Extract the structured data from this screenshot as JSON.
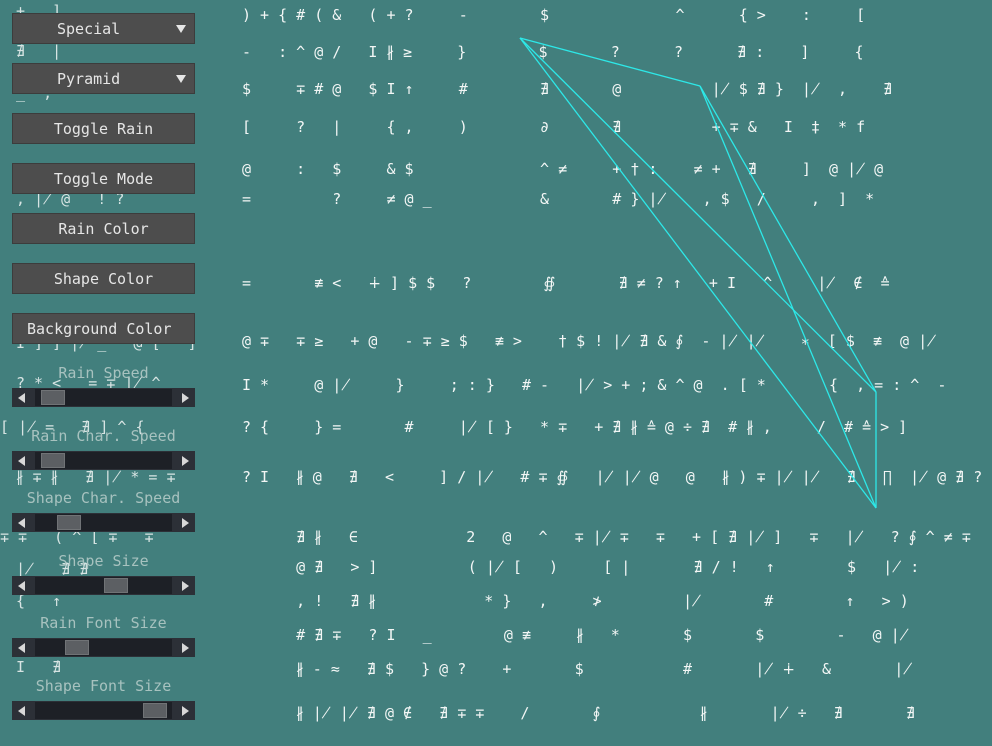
{
  "colors": {
    "background": "#427f7d",
    "rain": "#f2f6f5",
    "shape": "#2de8e8"
  },
  "controls": {
    "effect_dropdown": "Special",
    "shape_dropdown": "Pyramid",
    "toggle_rain": "Toggle Rain",
    "toggle_mode": "Toggle Mode",
    "rain_color": "Rain Color",
    "shape_color": "Shape Color",
    "background_color": "Background Color"
  },
  "sliders": [
    {
      "label": "Rain Speed",
      "value": 0.05
    },
    {
      "label": "Rain Char. Speed",
      "value": 0.05
    },
    {
      "label": "Shape Char. Speed",
      "value": 0.2
    },
    {
      "label": "Shape Size",
      "value": 0.62
    },
    {
      "label": "Rain Font Size",
      "value": 0.27
    },
    {
      "label": "Shape Font Size",
      "value": 0.97
    }
  ],
  "rain_rows": [
    ") + { # ( &   ( + ?     -        $              ^      { >    :     [",
    "-   : ^ @ /   I ∦ ≥     }        $       ?      ?      ∄ :    ]     {",
    "$     ∓ # @   $ I ↑     #        ∄       @          ∤ $ ∄ }  ∤  ,    ∄",
    "[     ?   |     { ,     )        ∂       ∄          + ∓ &   I  ‡  * f",
    "@     :   $     & $              ^ ≠     + † :    ≠ +   ∄     ]  @ ∤ @",
    "=         ?     ≠ @ _            &       # } ∤    , $   /     ,  ]  *",
    "=       ≢ <   ∔ ] $ $   ?        ∯       ∄ ≠ ? ↑   + I   ^     ∤  ∉  ≙",
    "@ ∓   ∓ ≥   + @   - ∓ ≥ $   ≢ >    † $ ! ∤ ∄ & ∮  - ∤ ∤    ∗  [ $  ≢  @ ∤",
    "I *     @ ∤     }     ; : }   # -   ∤ > + ; & ^ @  . [ *       {  , = : ^  -",
    "? {     } =       #     ∤ [ }   * ∓   + ∄ ∦ ≙ @ ÷ ∄  # ∦ ,     /  # ≙ > ]",
    "? I   ∦ @   ∄   <     ] ∕ ∤   # ∓ ∯   ∤ ∤ @   @   ∦ ) ∓ ∤ ∤   ∄   ∏  ∤ @ ∄ ? $",
    "      ∄ ∦   ∈            2   @   ^   ∓ ∤ ∓   ∓   + [ ∄ ∤ ]   ∓   ∤   ? ∮ ^ ≠ ∓",
    "      @ ∄   > ]          ( ∤ [   )     [ |       ∄ / !   ↑        $   ∤ :",
    "      , !   ∄ ∦            * }   ,     ≯         ∤       #        ↑   > )",
    "      # ∄ ∓   ? I   _        @ ≢     ∦   *       $       $        -   @ ∤",
    "      ∦ - ≈   ∄ $   } @ ?    +       $           #       ∤ ∔   &       ∤",
    "      ∦ ∤ ∤ ∄ @ ∉   ∄ ∓ ∓    ∕       ∮           ∦       ∤ ÷   ∄       ∄"
  ],
  "left_rain": [
    "+   ]",
    "∄   |",
    "_  ,",
    "",
    ",   †",
    ", ∤ @   ! ?",
    "",
    "",
    "",
    "I ] ] ∤ _   @ [   ]",
    "? * <   = ∓ ∤ ^",
    "[ ∤ =   ∄ ] ^ {",
    "∦ ∓ ∦   ∄ ∤ * = ∓",
    "∓ ∓   ( ^ [ ∓   ∓",
    "∤   ∄ ∄",
    "{   ↑",
    "I   ∄"
  ]
}
